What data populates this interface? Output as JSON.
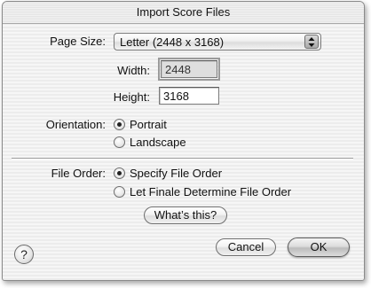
{
  "window": {
    "title": "Import Score Files"
  },
  "page_size": {
    "label": "Page Size:",
    "selected": "Letter (2448 x 3168)"
  },
  "width": {
    "label": "Width:",
    "value": "2448"
  },
  "height": {
    "label": "Height:",
    "value": "3168"
  },
  "orientation": {
    "label": "Orientation:",
    "options": [
      {
        "label": "Portrait",
        "checked": true
      },
      {
        "label": "Landscape",
        "checked": false
      }
    ]
  },
  "file_order": {
    "label": "File Order:",
    "options": [
      {
        "label": "Specify File Order",
        "checked": true
      },
      {
        "label": "Let Finale Determine File Order",
        "checked": false
      }
    ],
    "whats_this_label": "What’s this?"
  },
  "buttons": {
    "help_label": "?",
    "cancel_label": "Cancel",
    "ok_label": "OK"
  }
}
